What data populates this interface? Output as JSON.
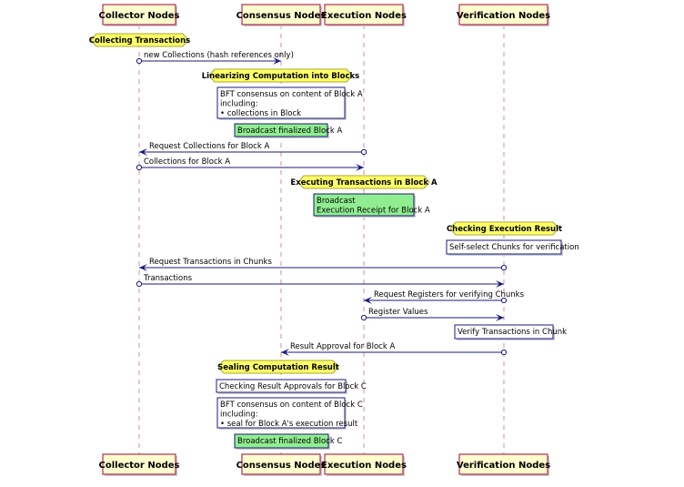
{
  "participants": [
    "Collector Nodes",
    "Consensus Nodes",
    "Execution Nodes",
    "Verification Nodes"
  ],
  "dividers": [
    "Collecting Transactions",
    "Linearizing Computation into Blocks",
    "Executing Transactions in Block A",
    "Checking Execution Result",
    "Sealing Computation Result"
  ],
  "messages": [
    "new Collections (hash references only)",
    "Request Collections for Block A",
    "Collections for Block A",
    "Request Transactions in Chunks",
    "Transactions",
    "Request Registers for verifying Chunks",
    "Register Values",
    "Result Approval for Block A"
  ],
  "notes": {
    "bft_a": [
      "BFT consensus on content of Block A",
      "including:",
      "• collections in Block"
    ],
    "broadcast_a": "Broadcast finalized Block A",
    "receipt": [
      "Broadcast",
      "Execution Receipt for Block A"
    ],
    "self_select": "Self-select Chunks for verification",
    "verify": "Verify Transactions in Chunk",
    "checking_approvals": "Checking Result Approvals for Block C",
    "bft_c": [
      "BFT consensus on content of Block C",
      "including:",
      "• seal for Block A's execution result"
    ],
    "broadcast_c": "Broadcast finalized Block C"
  },
  "colors": {
    "participant": "#FEFECE",
    "divider": "#FFFF66",
    "green_note": "#90EE90",
    "arrow": "#181880"
  }
}
